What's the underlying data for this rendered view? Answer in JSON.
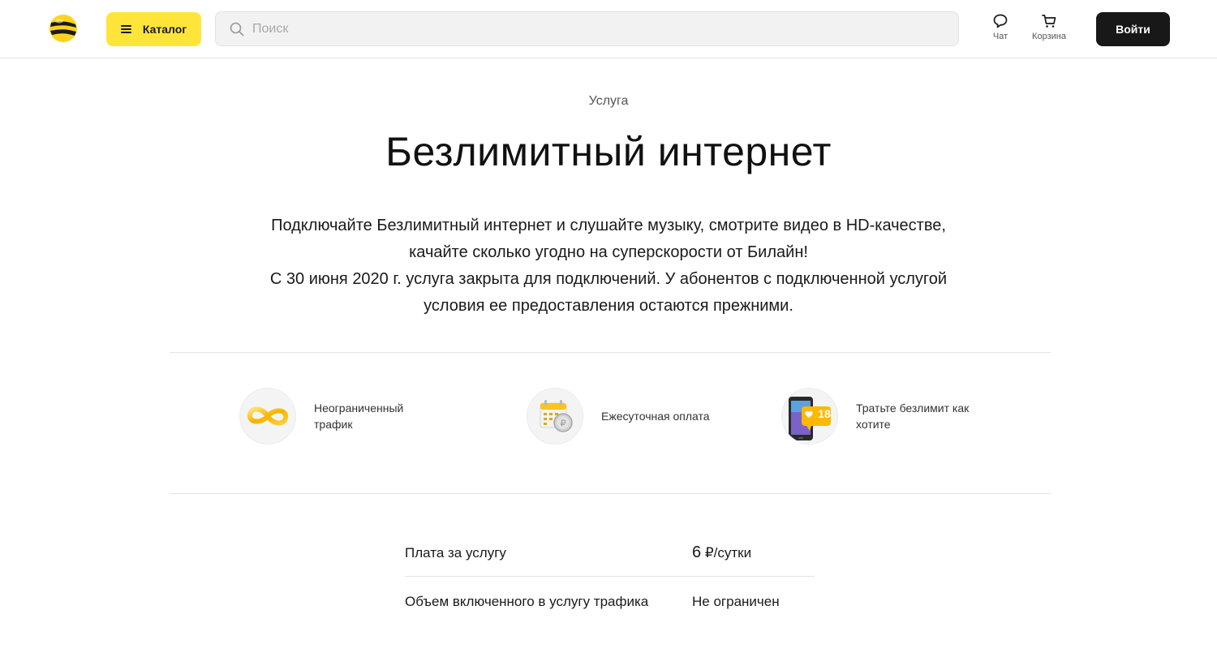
{
  "header": {
    "catalog_label": "Каталог",
    "search_placeholder": "Поиск",
    "chat_label": "Чат",
    "cart_label": "Корзина",
    "login_label": "Войти"
  },
  "hero": {
    "kicker": "Услуга",
    "title": "Безлимитный интернет",
    "description_line1": "Подключайте Безлимитный интернет и слушайте музыку, смотрите видео в HD-качестве, качайте сколько угодно на суперскорости от Билайн!",
    "description_line2": "С 30 июня 2020 г. услуга закрыта для подключений. У абонентов с подключенной услугой условия ее предоставления остаются прежними."
  },
  "features": [
    {
      "label": "Неограниченный трафик",
      "icon": "infinity-icon"
    },
    {
      "label": "Ежесуточная оплата",
      "icon": "calendar-coin-icon"
    },
    {
      "label": "Тратьте безлимит как хотите",
      "icon": "phone-likes-icon",
      "badge": "18"
    }
  ],
  "details": [
    {
      "key": "Плата за услугу",
      "value_number": "6",
      "value_unit": "₽/сутки"
    },
    {
      "key": "Объем включенного в услугу трафика",
      "value": "Не ограничен"
    }
  ],
  "colors": {
    "brand_yellow": "#ffe53a",
    "dark": "#181818"
  }
}
